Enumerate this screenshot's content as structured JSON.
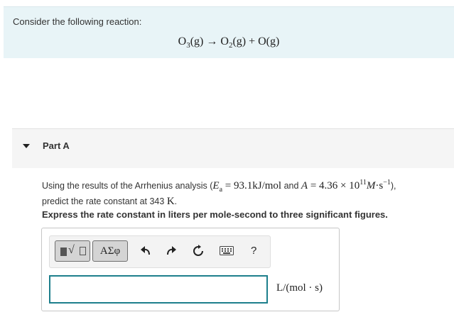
{
  "intro": {
    "text": "Consider the following reaction:",
    "equation": {
      "reactant": "O",
      "reactant_sub": "3",
      "reactant_state": "(g)",
      "arrow": "→",
      "product1": "O",
      "product1_sub": "2",
      "product1_state": "(g)",
      "plus": "+",
      "product2": "O(g)"
    }
  },
  "part": {
    "label": "Part A",
    "expanded": true
  },
  "question": {
    "prefix": "Using the results of the Arrhenius analysis (",
    "ea_symbol": "E",
    "ea_sub": "a",
    "ea_value": "= 93.1kJ/mol",
    "and": " and ",
    "a_symbol": "A",
    "a_value_prefix": "= 4.36 × 10",
    "a_exp": "11",
    "a_units": "M",
    "a_units_dot": "·",
    "a_units_s": "s",
    "a_units_exp": "−1",
    "suffix": "),",
    "line2_prefix": "predict the rate constant at 343 ",
    "temp_unit": "K",
    "line2_suffix": "."
  },
  "instruction": "Express the rate constant in liters per mole-second to three significant figures.",
  "toolbar": {
    "greek_label": "ΑΣφ",
    "help_label": "?"
  },
  "answer": {
    "value": "",
    "units": "L/(mol · s)"
  },
  "colors": {
    "intro_bg": "#e8f4f7",
    "input_border": "#1d7f8c"
  }
}
